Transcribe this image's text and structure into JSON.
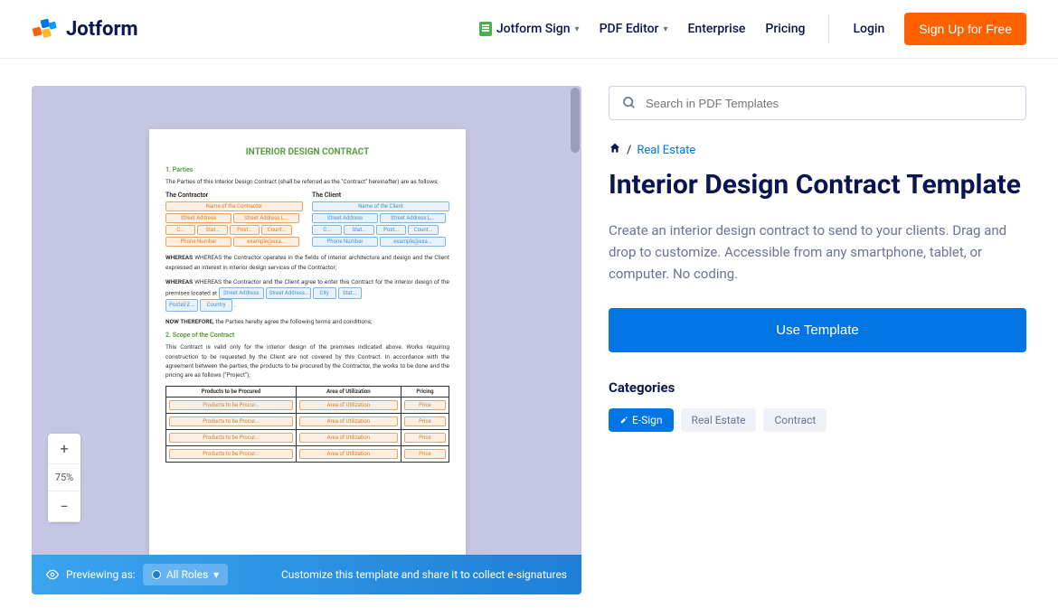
{
  "header": {
    "logo_text": "Jotform",
    "nav": {
      "sign": "Jotform Sign",
      "pdf": "PDF Editor",
      "enterprise": "Enterprise",
      "pricing": "Pricing",
      "login": "Login",
      "signup": "Sign Up for Free"
    }
  },
  "preview": {
    "zoom_level": "75%",
    "bottom": {
      "preview_as": "Previewing as:",
      "roles": "All Roles",
      "customize": "Customize this template and share it to collect e-signatures"
    }
  },
  "doc": {
    "title": "INTERIOR DESIGN CONTRACT",
    "s1": "1. Parties",
    "parties_intro": "The Parties of this Interior Design Contract (shall be referred as the \"Contract\" hereinafter) are as follows;",
    "contractor_head": "The Contractor",
    "client_head": "The Client",
    "contractor_name": "Name of the Contractor",
    "client_name": "Name of the Client",
    "street": "Street Address",
    "street2": "Street Address L...",
    "city_s": "C...",
    "state_s": "Stat...",
    "post_s": "Post...",
    "country_s": "Count...",
    "phone": "Phone Number",
    "email": "example@exa...",
    "whereas1": "WHEREAS the Contractor operates in the fields of interior architecture and design and the Client expressed an interest in interior design services of the Contractor;",
    "whereas2_pre": "WHEREAS the Contractor and the Client agree to enter this Contract for the interior design of the premises located at ",
    "loc_street": "Street Address",
    "loc_street2": "Street Address...",
    "loc_city": "City",
    "loc_state": "Stat...",
    "loc_postal": "Postal/Z...",
    "loc_country": "Country",
    "now": "NOW THEREFORE, the Parties hereby agree the following terms and conditions;",
    "s2": "2. Scope of the Contract",
    "scope_text": "This Contract is valid only for the interior design of the premises indicated above. Works requiring construction to be requested by the Client are not covered by this Contract. In accordance with the agreement between the parties, the products to be procured by the Contractor, the works to be done and the pricing are as follows (\"Project\");",
    "th1": "Products to be Procured",
    "th2": "Area of Utilization",
    "th3": "Pricing",
    "td1": "Products to be Procur...",
    "td2": "Area of Utilization",
    "td3": "Price"
  },
  "right": {
    "search_placeholder": "Search in PDF Templates",
    "breadcrumb_link": "Real Estate",
    "title": "Interior Design Contract Template",
    "desc": "Create an interior design contract to send to your clients. Drag and drop to customize. Accessible from any smartphone, tablet, or computer. No coding.",
    "use_template": "Use Template",
    "categories": "Categories",
    "tags": {
      "esign": "E-Sign",
      "realestate": "Real Estate",
      "contract": "Contract"
    }
  }
}
